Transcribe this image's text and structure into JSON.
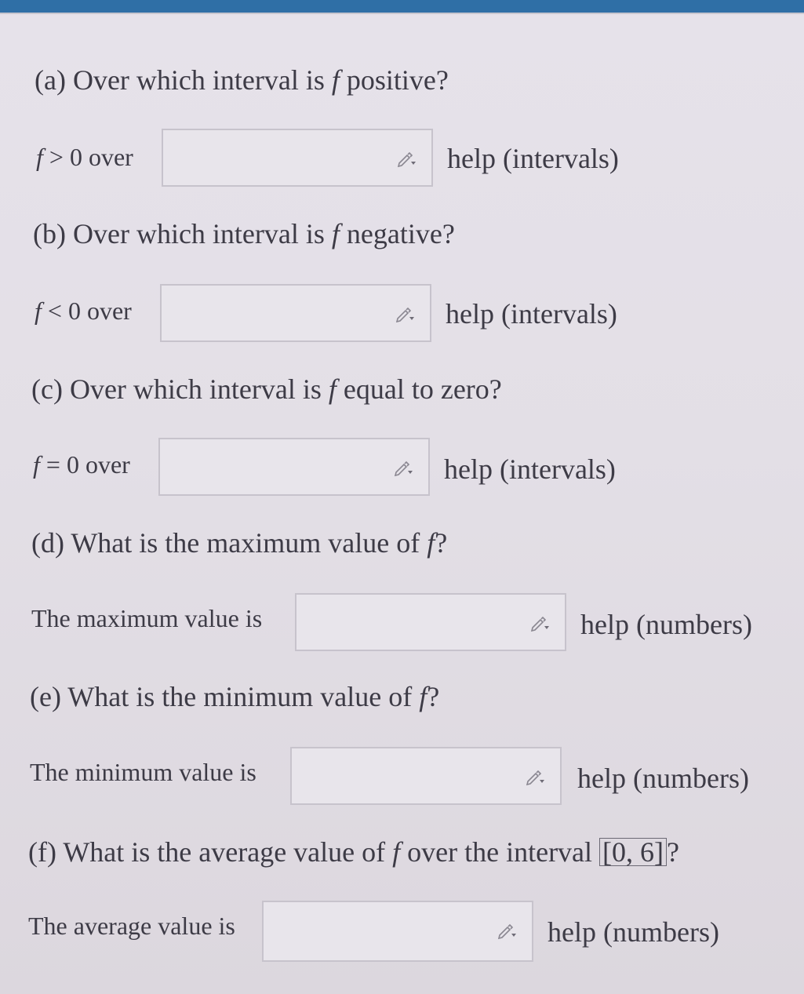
{
  "questions": {
    "a": {
      "text": "(a) Over which interval is ",
      "var": "f",
      "tail": " positive?"
    },
    "b": {
      "text": "(b) Over which interval is ",
      "var": "f",
      "tail": " negative?"
    },
    "c": {
      "text": "(c) Over which interval is ",
      "var": "f",
      "tail": " equal to zero?"
    },
    "d": {
      "text": "(d) What is the maximum value of ",
      "var": "f",
      "tail": "?"
    },
    "e": {
      "text": "(e) What is the minimum value of ",
      "var": "f",
      "tail": "?"
    },
    "f": {
      "text": "(f) What is the average value of ",
      "var": "f",
      "mid": " over the interval ",
      "interval": "[0, 6]",
      "tail": "?"
    }
  },
  "answers": {
    "a": {
      "var": "f",
      "rel": " > 0 over",
      "value": "",
      "help": "help (intervals)"
    },
    "b": {
      "var": "f",
      "rel": " < 0 over",
      "value": "",
      "help": "help (intervals)"
    },
    "c": {
      "var": "f",
      "rel": " = 0 over",
      "value": "",
      "help": "help (intervals)"
    },
    "d": {
      "label": "The maximum value is",
      "value": "",
      "help": "help (numbers)"
    },
    "e": {
      "label": "The minimum value is",
      "value": "",
      "help": "help (numbers)"
    },
    "f": {
      "label": "The average value is",
      "value": "",
      "help": "help (numbers)"
    }
  },
  "icons": {
    "input_icon": "pencil-dropdown-icon"
  },
  "colors": {
    "text": "#3d3b46",
    "background": "#e4e0e7",
    "input_border": "#c7c3cc",
    "top_bar": "#2f6fa6"
  }
}
